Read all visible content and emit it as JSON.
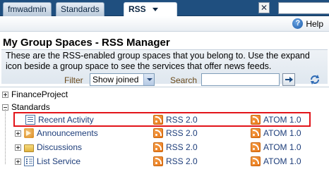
{
  "tabs": [
    {
      "label": "fmwadmin"
    },
    {
      "label": "Standards"
    },
    {
      "label": "RSS",
      "active": true,
      "has_menu": true
    }
  ],
  "help_label": "Help",
  "page_title": "My Group Spaces - RSS Manager",
  "description": "These are the RSS-enabled group spaces that you belong to. Use the expand icon beside a group space to see the services that offer news feeds.",
  "filter": {
    "label": "Filter",
    "selected": "Show joined"
  },
  "search": {
    "label": "Search",
    "value": ""
  },
  "tree": {
    "groups": [
      {
        "name": "FinanceProject",
        "expanded": false
      },
      {
        "name": "Standards",
        "expanded": true
      }
    ],
    "services": [
      {
        "name": "Recent Activity",
        "icon": "recent-activity-icon",
        "expandable": false,
        "rss": "RSS 2.0",
        "atom": "ATOM 1.0",
        "highlighted": true
      },
      {
        "name": "Announcements",
        "icon": "announcement-icon",
        "expandable": true,
        "rss": "RSS 2.0",
        "atom": "ATOM 1.0"
      },
      {
        "name": "Discussions",
        "icon": "folder-icon",
        "expandable": true,
        "rss": "RSS 2.0",
        "atom": "ATOM 1.0"
      },
      {
        "name": "List Service",
        "icon": "list-icon",
        "expandable": true,
        "rss": "RSS 2.0",
        "atom": "ATOM 1.0"
      }
    ]
  },
  "colors": {
    "tab_bar": "#1f4f7f",
    "highlight_border": "#e2141a",
    "feed_orange": "#e8781a",
    "label_brown": "#6b4a1a"
  }
}
